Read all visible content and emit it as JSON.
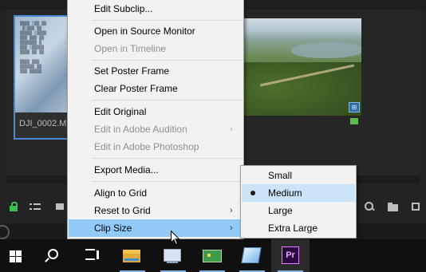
{
  "project_panel": {
    "clips": [
      {
        "name": "DJI_0002.M"
      }
    ]
  },
  "context_menu": {
    "items": [
      {
        "label": "Edit Subclip...",
        "enabled": true
      },
      {
        "label": "Open in Source Monitor",
        "enabled": true
      },
      {
        "label": "Open in Timeline",
        "enabled": false
      },
      {
        "label": "Set Poster Frame",
        "enabled": true
      },
      {
        "label": "Clear Poster Frame",
        "enabled": true
      },
      {
        "label": "Edit Original",
        "enabled": true
      },
      {
        "label": "Edit in Adobe Audition",
        "enabled": false,
        "submenu": true
      },
      {
        "label": "Edit in Adobe Photoshop",
        "enabled": false
      },
      {
        "label": "Export Media...",
        "enabled": true
      },
      {
        "label": "Align to Grid",
        "enabled": true
      },
      {
        "label": "Reset to Grid",
        "enabled": true,
        "submenu": true
      },
      {
        "label": "Clip Size",
        "enabled": true,
        "submenu": true,
        "highlighted": true
      }
    ],
    "submenu_arrow": "›"
  },
  "clip_size_submenu": {
    "items": [
      {
        "label": "Small"
      },
      {
        "label": "Medium",
        "selected": true
      },
      {
        "label": "Large"
      },
      {
        "label": "Extra Large"
      }
    ]
  },
  "taskbar": {
    "apps": [
      {
        "icon": "windows-start-icon"
      },
      {
        "icon": "search-icon"
      },
      {
        "icon": "task-view-icon"
      },
      {
        "icon": "file-explorer-icon",
        "active": true
      },
      {
        "icon": "system-monitor-icon",
        "active": true
      },
      {
        "icon": "circuit-board-icon",
        "active": true
      },
      {
        "icon": "document-app-icon",
        "active": true
      },
      {
        "icon": "premiere-pro-icon",
        "label": "Pr",
        "active": true,
        "focused": true
      }
    ]
  },
  "colors": {
    "accent_blue": "#91c9f7",
    "selection_border": "#4a8ad6",
    "lock_green": "#3bbf4e",
    "premiere_purple": "#e07fff"
  }
}
